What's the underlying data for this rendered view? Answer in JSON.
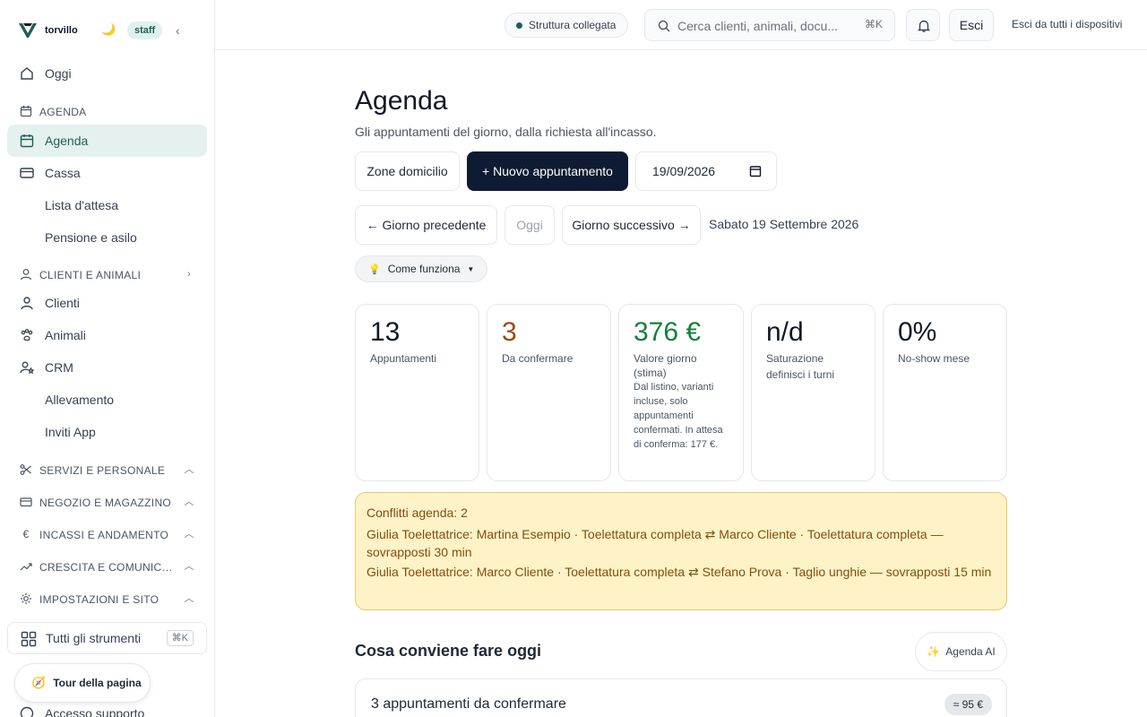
{
  "brand": {
    "name": "torvillo",
    "logo_color": "#1f5f57",
    "role_badge": "staff"
  },
  "sidebar": {
    "top_item": {
      "label": "Oggi",
      "icon": "home-icon"
    },
    "agenda_section": {
      "label": "AGENDA",
      "icon": "calendar-icon"
    },
    "agenda_items": [
      {
        "label": "Agenda",
        "icon": "calendar-icon",
        "active": true
      },
      {
        "label": "Cassa",
        "icon": "card-icon"
      },
      {
        "label": "Lista d'attesa"
      },
      {
        "label": "Pensione e asilo"
      }
    ],
    "clients_section": {
      "label": "CLIENTI E ANIMALI",
      "icon": "user-icon"
    },
    "clients_items": [
      {
        "label": "Clienti",
        "icon": "user-icon"
      },
      {
        "label": "Animali",
        "icon": "paw-icon"
      },
      {
        "label": "CRM",
        "icon": "user-star-icon"
      },
      {
        "label": "Allevamento"
      },
      {
        "label": "Inviti App"
      }
    ],
    "collapsed_sections": [
      {
        "label": "SERVIZI E PERSONALE",
        "icon": "scissors-icon"
      },
      {
        "label": "NEGOZIO E MAGAZZINO",
        "icon": "card-icon"
      },
      {
        "label": "INCASSI E ANDAMENTO",
        "icon": "euro-icon"
      },
      {
        "label": "CRESCITA E COMUNICA...",
        "icon": "trend-icon"
      },
      {
        "label": "IMPOSTAZIONI E SITO",
        "icon": "sun-gear-icon"
      }
    ],
    "tools_button": {
      "label": "Tutti gli strumenti",
      "shortcut": "⌘K"
    },
    "tour_button": {
      "label": "Tour della pagina"
    },
    "support_link": {
      "label": "Accesso supporto"
    }
  },
  "topbar": {
    "structure_status": "Struttura collegata",
    "search_placeholder": "Cerca clienti, animali, docu...",
    "search_shortcut": "⌘K",
    "logout_label": "Esci",
    "logout_all_label": "Esci da tutti i dispositivi"
  },
  "page": {
    "title": "Agenda",
    "subtitle": "Gli appuntamenti del giorno, dalla richiesta all'incasso.",
    "zones_button": "Zone domicilio",
    "new_appointment_button": "+ Nuovo appuntamento",
    "date_value": "19/09/2026",
    "prev_day_button": "← Giorno precedente",
    "today_button": "Oggi",
    "next_day_button": "Giorno successivo →",
    "date_label": "Sabato 19 Settembre 2026",
    "how_it_works": "Come funziona"
  },
  "stats": [
    {
      "value": "13",
      "label": "Appuntamenti",
      "note": "",
      "color": "#111827"
    },
    {
      "value": "3",
      "label": "Da confermare",
      "note": "",
      "color": "#9a4a12"
    },
    {
      "value": "376 €",
      "label": "Valore giorno (stima)",
      "note": "Dal listino, varianti incluse, solo appuntamenti confermati. In attesa di conferma: 177 €.",
      "color": "#15803d"
    },
    {
      "value": "n/d",
      "label": "Saturazione",
      "note": "definisci i turni",
      "color": "#111827"
    },
    {
      "value": "0%",
      "label": "No-show mese",
      "note": "",
      "color": "#111827"
    }
  ],
  "conflicts": {
    "title": "Conflitti agenda: 2",
    "lines": [
      "Giulia Toelettatrice: Martina Esempio · Toelettatura completa ⇄ Marco Cliente · Toelettatura completa — sovrapposti 30 min",
      "Giulia Toelettatrice: Marco Cliente · Toelettatura completa ⇄ Stefano Prova · Taglio unghie — sovrapposti 15 min"
    ]
  },
  "todo": {
    "title": "Cosa conviene fare oggi",
    "ai_button": "Agenda AI",
    "first_card": {
      "label": "3 appuntamenti da confermare",
      "badge": "≈ 95 €"
    }
  }
}
